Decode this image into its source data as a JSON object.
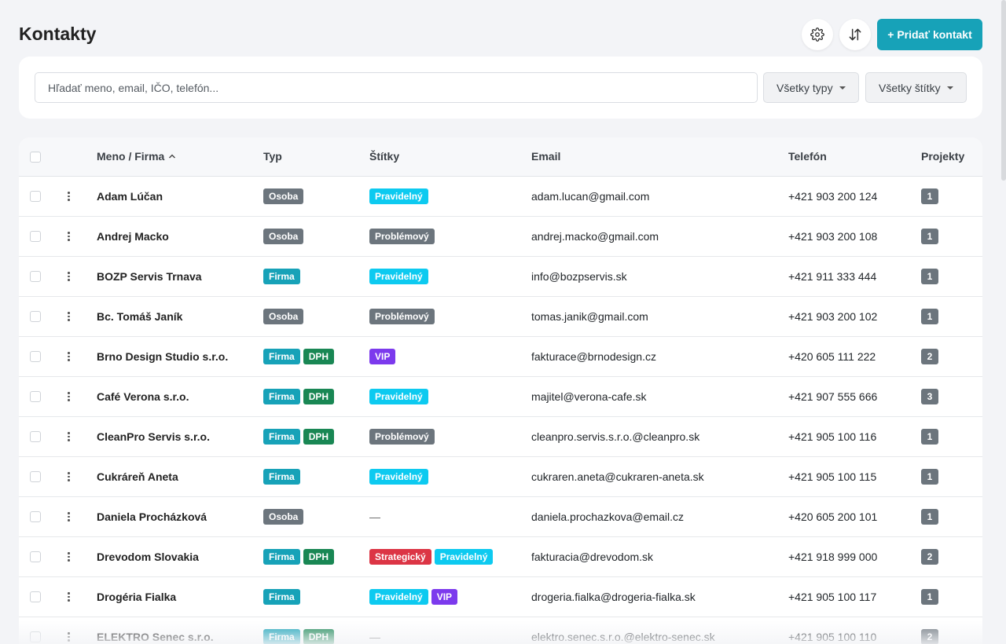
{
  "page": {
    "title": "Kontakty",
    "add_button": "+ Pridať kontakt",
    "settings_icon": "gear-icon",
    "sort_icon": "sort-arrows-icon"
  },
  "filters": {
    "search_placeholder": "Hľadať meno, email, IČO, telefón...",
    "type_filter": "Všetky typy",
    "tags_filter": "Všetky štítky"
  },
  "table": {
    "columns": {
      "name": "Meno / Firma",
      "type": "Typ",
      "tags": "Štítky",
      "email": "Email",
      "phone": "Telefón",
      "projects": "Projekty"
    },
    "sort": {
      "column": "name",
      "direction": "asc"
    },
    "rows": [
      {
        "name": "Adam Lúčan",
        "types": [
          "Osoba"
        ],
        "tags": [
          "Pravidelný"
        ],
        "email": "adam.lucan@gmail.com",
        "phone": "+421 903 200 124",
        "projects": "1"
      },
      {
        "name": "Andrej Macko",
        "types": [
          "Osoba"
        ],
        "tags": [
          "Problémový"
        ],
        "email": "andrej.macko@gmail.com",
        "phone": "+421 903 200 108",
        "projects": "1"
      },
      {
        "name": "BOZP Servis Trnava",
        "types": [
          "Firma"
        ],
        "tags": [
          "Pravidelný"
        ],
        "email": "info@bozpservis.sk",
        "phone": "+421 911 333 444",
        "projects": "1"
      },
      {
        "name": "Bc. Tomáš Janík",
        "types": [
          "Osoba"
        ],
        "tags": [
          "Problémový"
        ],
        "email": "tomas.janik@gmail.com",
        "phone": "+421 903 200 102",
        "projects": "1"
      },
      {
        "name": "Brno Design Studio s.r.o.",
        "types": [
          "Firma",
          "DPH"
        ],
        "tags": [
          "VIP"
        ],
        "email": "fakturace@brnodesign.cz",
        "phone": "+420 605 111 222",
        "projects": "2"
      },
      {
        "name": "Café Verona s.r.o.",
        "types": [
          "Firma",
          "DPH"
        ],
        "tags": [
          "Pravidelný"
        ],
        "email": "majitel@verona-cafe.sk",
        "phone": "+421 907 555 666",
        "projects": "3"
      },
      {
        "name": "CleanPro Servis s.r.o.",
        "types": [
          "Firma",
          "DPH"
        ],
        "tags": [
          "Problémový"
        ],
        "email": "cleanpro.servis.s.r.o.@cleanpro.sk",
        "phone": "+421 905 100 116",
        "projects": "1"
      },
      {
        "name": "Cukráreň Aneta",
        "types": [
          "Firma"
        ],
        "tags": [
          "Pravidelný"
        ],
        "email": "cukraren.aneta@cukraren-aneta.sk",
        "phone": "+421 905 100 115",
        "projects": "1"
      },
      {
        "name": "Daniela Procházková",
        "types": [
          "Osoba"
        ],
        "tags": [],
        "email": "daniela.prochazkova@email.cz",
        "phone": "+420 605 200 101",
        "projects": "1"
      },
      {
        "name": "Drevodom Slovakia",
        "types": [
          "Firma",
          "DPH"
        ],
        "tags": [
          "Strategický",
          "Pravidelný"
        ],
        "email": "fakturacia@drevodom.sk",
        "phone": "+421 918 999 000",
        "projects": "2"
      },
      {
        "name": "Drogéria Fialka",
        "types": [
          "Firma"
        ],
        "tags": [
          "Pravidelný",
          "VIP"
        ],
        "email": "drogeria.fialka@drogeria-fialka.sk",
        "phone": "+421 905 100 117",
        "projects": "1"
      },
      {
        "name": "ELEKTRO Senec s.r.o.",
        "types": [
          "Firma",
          "DPH"
        ],
        "tags": [],
        "email": "elektro.senec.s.r.o.@elektro-senec.sk",
        "phone": "+421 905 100 110",
        "projects": "2"
      }
    ],
    "empty_tags": "—"
  },
  "colors": {
    "accent": "#17a2b8",
    "Osoba": "#6c757d",
    "Firma": "#17a2b8",
    "DPH": "#198754",
    "Pravidelný": "#0dcaf0",
    "Problémový": "#6c757d",
    "VIP": "#7c3aed",
    "Strategický": "#dc3545"
  }
}
